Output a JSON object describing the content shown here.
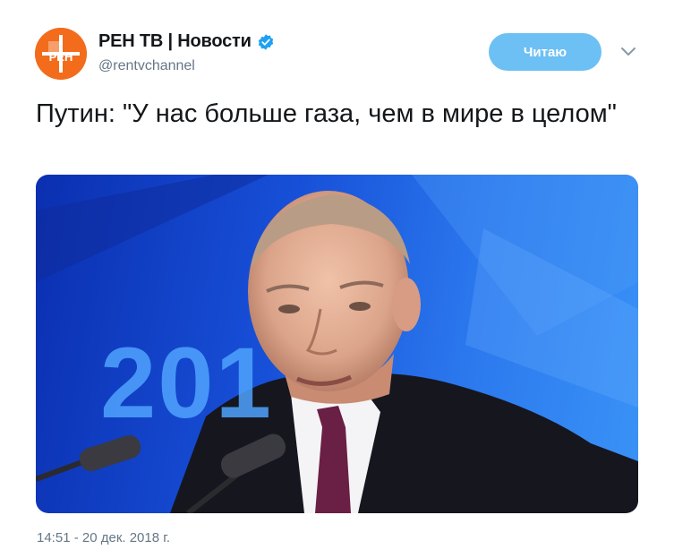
{
  "account": {
    "display_name": "РЕН ТВ | Новости",
    "handle": "@rentvchannel",
    "avatar_icon": "ren-tv-logo",
    "verified_icon": "verified-badge-icon",
    "verified_color": "#1da1f2",
    "avatar_color": "#f26c1c"
  },
  "actions": {
    "follow_label": "Читаю",
    "follow_color": "#6cc0f4",
    "more_icon": "chevron-down-icon"
  },
  "tweet": {
    "text": "Путин: \"У нас больше газа, чем в мире в целом\"",
    "media": {
      "background_text": "201"
    },
    "timestamp": "14:51 - 20 дек. 2018 г."
  },
  "colors": {
    "text_primary": "#14171a",
    "text_secondary": "#657786"
  }
}
